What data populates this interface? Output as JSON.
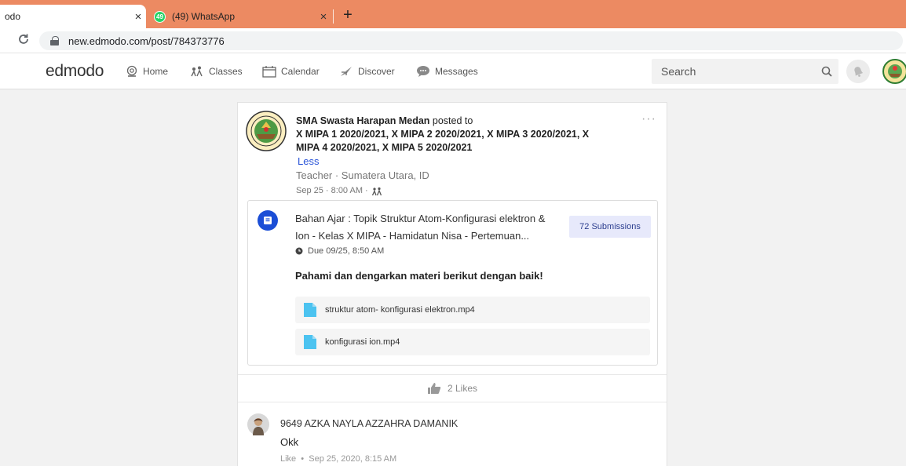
{
  "browser": {
    "tabs": [
      {
        "title": "odo",
        "close": "×"
      },
      {
        "title": "(49) WhatsApp",
        "badge": "49",
        "close": "×"
      }
    ],
    "new_tab": "+",
    "url": "new.edmodo.com/post/784373776"
  },
  "nav": {
    "logo": "edmodo",
    "items": [
      {
        "label": "Home",
        "icon": "home-icon"
      },
      {
        "label": "Classes",
        "icon": "classes-icon"
      },
      {
        "label": "Calendar",
        "icon": "calendar-icon"
      },
      {
        "label": "Discover",
        "icon": "discover-icon"
      },
      {
        "label": "Messages",
        "icon": "messages-icon"
      }
    ],
    "search_placeholder": "Search"
  },
  "post": {
    "author": "SMA Swasta Harapan Medan",
    "posted_to": " posted to ",
    "groups": "X MIPA 1 2020/2021,  X MIPA 2 2020/2021,  X MIPA 3 2020/2021,  X MIPA 4 2020/2021,  X MIPA 5 2020/2021",
    "less": "Less",
    "author_meta": "Teacher · Sumatera Utara, ID",
    "time": "Sep 25 · 8:00 AM  · ",
    "more": "···",
    "assignment": {
      "title": "Bahan Ajar : Topik Struktur Atom-Konfigurasi elektron & Ion - Kelas X MIPA - Hamidatun Nisa - Pertemuan...",
      "submissions": "72 Submissions",
      "due": "Due 09/25, 8:50 AM",
      "instruction": "Pahami dan dengarkan materi berikut dengan baik!",
      "files": [
        {
          "name": "struktur atom- konfigurasi elektron.mp4"
        },
        {
          "name": "konfigurasi ion.mp4"
        }
      ]
    },
    "likes": "2 Likes"
  },
  "comment": {
    "author": "9649 AZKA NAYLA AZZAHRA DAMANIK",
    "text": "Okk",
    "like_label": "Like",
    "separator": "  •  ",
    "timestamp": "Sep 25, 2020, 8:15 AM"
  },
  "colors": {
    "tabbar": "#ec8a62",
    "accent_blue": "#1b4ed6",
    "link_blue": "#2b55d8",
    "file_icon": "#4cc3f0"
  }
}
